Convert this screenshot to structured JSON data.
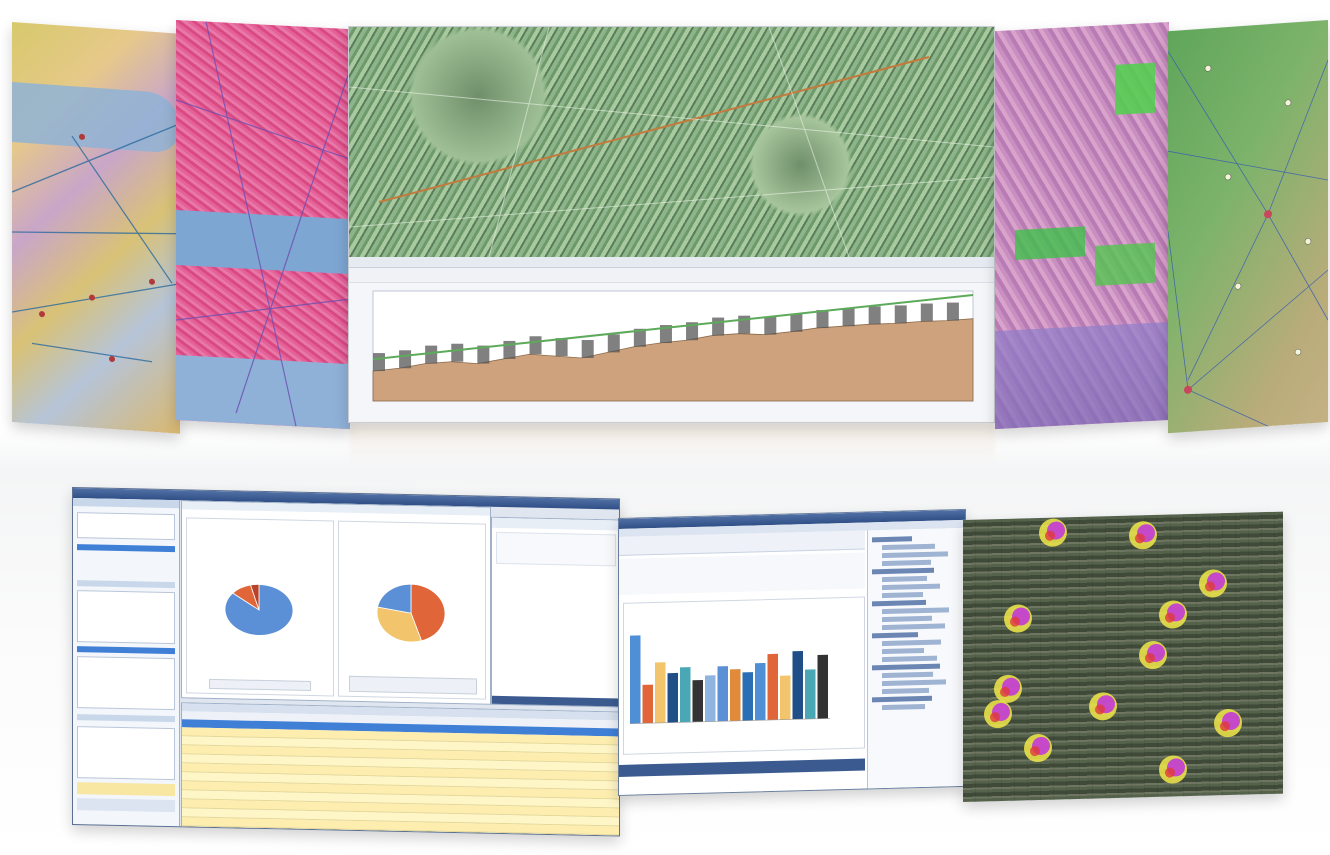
{
  "scene": "composite",
  "panels": [
    {
      "id": "map-topo-left",
      "kind": "topographic-map"
    },
    {
      "id": "map-street-pink",
      "kind": "street-map"
    },
    {
      "id": "map-satellite-center",
      "kind": "terrain-map-with-profile"
    },
    {
      "id": "map-street-purple",
      "kind": "street-map"
    },
    {
      "id": "map-network-right",
      "kind": "network-map"
    },
    {
      "id": "app-pie-charts",
      "kind": "analytics-window"
    },
    {
      "id": "app-bar-chart",
      "kind": "analytics-window"
    },
    {
      "id": "map-heat-satellite",
      "kind": "heatmap"
    }
  ],
  "colors": {
    "profile_fill": "#cda27c",
    "profile_line": "#5daa5a",
    "pie_blue": "#5b8fd6",
    "pie_orange": "#e0663a",
    "pie_yellow": "#f2c46b",
    "window_title": "#2f4f86",
    "bar_colors": [
      "#4f8fd6",
      "#e0663a",
      "#f2c46b",
      "#1f4f86",
      "#4aa7b5",
      "#333333",
      "#8fb4e0",
      "#5b8fd6",
      "#e08a3a",
      "#2a6fb5"
    ]
  },
  "profile_series": [
    0.32,
    0.35,
    0.4,
    0.42,
    0.4,
    0.45,
    0.5,
    0.48,
    0.46,
    0.52,
    0.58,
    0.62,
    0.65,
    0.7,
    0.72,
    0.71,
    0.74,
    0.78,
    0.8,
    0.82,
    0.83,
    0.85,
    0.86,
    0.88
  ],
  "pie_left": [
    0.86,
    0.1,
    0.04
  ],
  "pie_right": [
    0.45,
    0.33,
    0.22
  ],
  "bar_values": [
    0.8,
    0.35,
    0.55,
    0.45,
    0.5,
    0.38,
    0.42,
    0.5,
    0.47,
    0.44,
    0.52,
    0.6,
    0.4,
    0.62,
    0.45,
    0.58
  ]
}
